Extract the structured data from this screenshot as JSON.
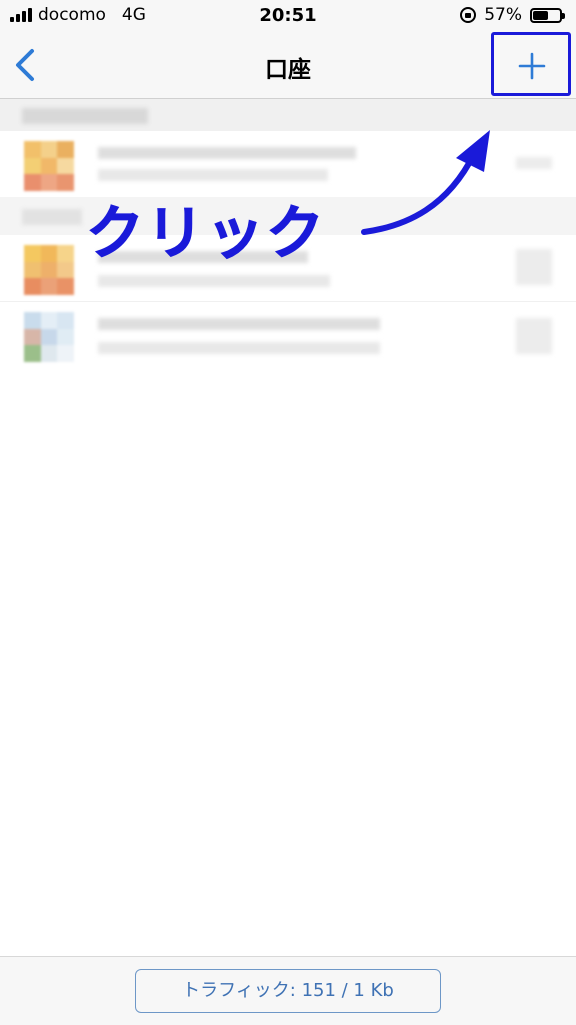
{
  "status_bar": {
    "carrier": "docomo",
    "network": "4G",
    "time": "20:51",
    "battery_percent": "57%",
    "battery_level": 0.57
  },
  "nav": {
    "title": "口座",
    "back_icon": "chevron-left-icon",
    "add_icon": "plus-icon"
  },
  "annotation": {
    "text": "クリック"
  },
  "footer": {
    "traffic_label": "トラフィック: 151 / 1 Kb"
  },
  "colors": {
    "accent_blue": "#2e7bd6",
    "annotation_blue": "#1a1ad9"
  }
}
